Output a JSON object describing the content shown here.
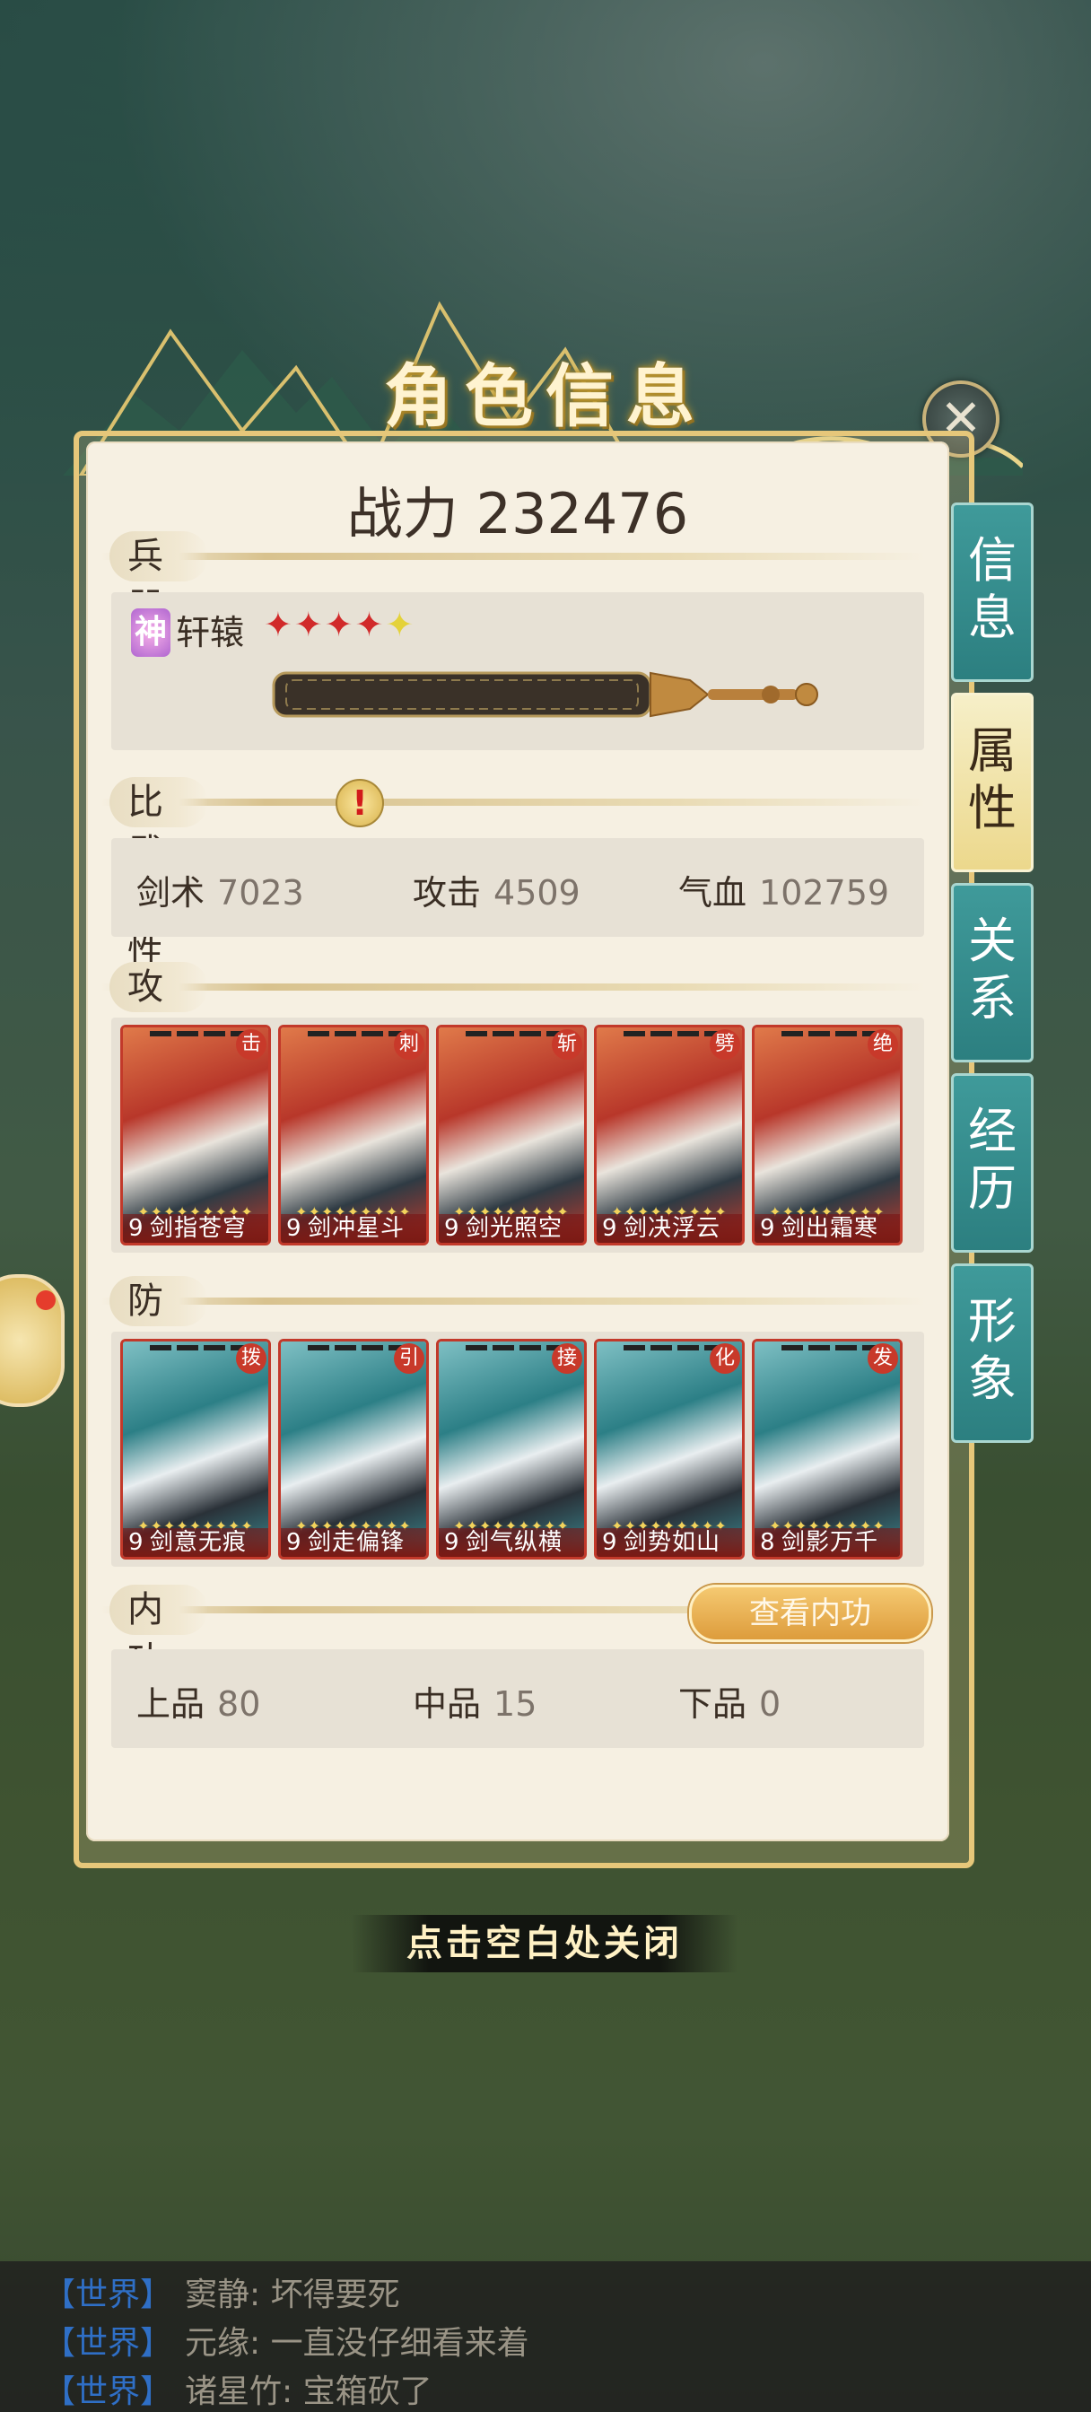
{
  "title": "角色信息",
  "power": {
    "label": "战力 232476"
  },
  "sections": {
    "weapon": "兵器",
    "battle_attr": "比武属性",
    "attack": "攻击招式",
    "defense": "防御招式",
    "inner": "内功"
  },
  "weapon": {
    "rarity_badge": "神",
    "name": "轩辕",
    "stars_red": "✦✦✦✦",
    "stars_gold": "✦"
  },
  "battle_stats": [
    {
      "label": "剑术",
      "value": "7023"
    },
    {
      "label": "攻击",
      "value": "4509"
    },
    {
      "label": "气血",
      "value": "102759"
    }
  ],
  "attack_moves": [
    {
      "badge": "击",
      "level": "9",
      "name": "剑指苍穹"
    },
    {
      "badge": "刺",
      "level": "9",
      "name": "剑冲星斗"
    },
    {
      "badge": "斩",
      "level": "9",
      "name": "剑光照空"
    },
    {
      "badge": "劈",
      "level": "9",
      "name": "剑决浮云"
    },
    {
      "badge": "绝",
      "level": "9",
      "name": "剑出霜寒"
    }
  ],
  "defense_moves": [
    {
      "badge": "拨",
      "level": "9",
      "name": "剑意无痕"
    },
    {
      "badge": "引",
      "level": "9",
      "name": "剑走偏锋"
    },
    {
      "badge": "接",
      "level": "9",
      "name": "剑气纵横"
    },
    {
      "badge": "化",
      "level": "9",
      "name": "剑势如山"
    },
    {
      "badge": "发",
      "level": "8",
      "name": "剑影万千"
    }
  ],
  "card_stars": "✦✦✦✦✦✦✦✦✦",
  "inner_stats": [
    {
      "label": "上品",
      "value": "80"
    },
    {
      "label": "中品",
      "value": "15"
    },
    {
      "label": "下品",
      "value": "0"
    }
  ],
  "view_inner_button": "查看内功",
  "tabs": [
    {
      "label": "信息",
      "active": false
    },
    {
      "label": "属性",
      "active": true
    },
    {
      "label": "关系",
      "active": false
    },
    {
      "label": "经历",
      "active": false
    },
    {
      "label": "形象",
      "active": false
    }
  ],
  "close_hint": "点击空白处关闭",
  "close_icon": "✕",
  "warning_icon": "!",
  "chat": [
    {
      "channel": "【世界】",
      "text": "窦静: 坏得要死"
    },
    {
      "channel": "【世界】",
      "text": "元缘: 一直没仔细看来着"
    },
    {
      "channel": "【世界】",
      "text": "诸星竹: 宝箱砍了"
    }
  ],
  "colors": {
    "accent_gold": "#e6c77a",
    "tab_teal": "#2c7f80",
    "card_red": "#c2392a",
    "chat_channel": "#2f6fc6"
  }
}
